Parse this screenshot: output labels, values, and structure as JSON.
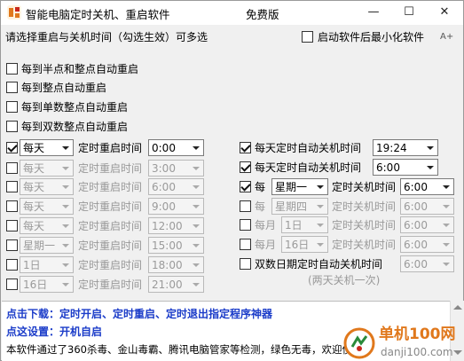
{
  "window": {
    "title": "智能电脑定时关机、重启软件",
    "edition": "免费版",
    "minimize_glyph": "—",
    "maximize_glyph": "☐",
    "close_glyph": "✕"
  },
  "header": {
    "instruction": "请选择重启与关机时间（勾选生效）可多选",
    "start_minimized": {
      "label": "启动软件后最小化软件",
      "checked": false
    },
    "font_size_icon": "A+"
  },
  "restart_options": [
    {
      "label": "每到半点和整点自动重启",
      "checked": false
    },
    {
      "label": "每到整点自动重启",
      "checked": false
    },
    {
      "label": "每到单数整点自动重启",
      "checked": false
    },
    {
      "label": "每到双数整点自动重启",
      "checked": false
    }
  ],
  "timed_restart": {
    "label": "定时重启时间",
    "rows": [
      {
        "checked": true,
        "day": "每天",
        "time": "0:00",
        "enabled": true
      },
      {
        "checked": false,
        "day": "每天",
        "time": "3:00",
        "enabled": false
      },
      {
        "checked": false,
        "day": "每天",
        "time": "6:00",
        "enabled": false
      },
      {
        "checked": false,
        "day": "每天",
        "time": "9:00",
        "enabled": false
      },
      {
        "checked": false,
        "day": "每天",
        "time": "12:00",
        "enabled": false
      },
      {
        "checked": false,
        "day": "星期一",
        "time": "15:00",
        "enabled": false
      },
      {
        "checked": false,
        "day": "1日",
        "time": "18:00",
        "enabled": false
      },
      {
        "checked": false,
        "day": "16日",
        "time": "21:00",
        "enabled": false
      }
    ]
  },
  "shutdown": {
    "rows": [
      {
        "checked": true,
        "label": "每天定时自动关机时间",
        "time": "19:24",
        "enabled": true
      },
      {
        "checked": true,
        "label": "每天定时自动关机时间",
        "time": "6:00",
        "enabled": true
      }
    ],
    "weekly": [
      {
        "checked": true,
        "prefix": "每",
        "day": "星期一",
        "label": "定时关机时间",
        "time": "6:00",
        "enabled": true
      },
      {
        "checked": false,
        "prefix": "每",
        "day": "星期四",
        "label": "定时关机时间",
        "time": "6:00",
        "enabled": false
      }
    ],
    "monthly": [
      {
        "checked": false,
        "prefix": "每月",
        "day": "1日",
        "label": "定时关机时间",
        "time": "6:00",
        "enabled": false
      },
      {
        "checked": false,
        "prefix": "每月",
        "day": "16日",
        "label": "定时关机时间",
        "time": "6:00",
        "enabled": false
      }
    ],
    "odd_even": {
      "checked": false,
      "label": "双数日期定时自动关机时间",
      "time": "6:00",
      "enabled": false
    },
    "note": "(两天关机一次)"
  },
  "footer": {
    "download_prefix": "点击下载：",
    "download_text": "定时开启、定时重启、定时退出指定程序神器",
    "settings_prefix": "点这设置：",
    "settings_text": "开机自启",
    "info": "本软件通过了360杀毒、金山毒霸、腾讯电脑管家等检测，绿色无毒，欢迎使"
  },
  "watermark": {
    "name": "单机100网",
    "url": "danji100.com"
  },
  "colors": {
    "link": "#1b3cc9",
    "icon_orange": "#e0781c",
    "icon_red": "#c8281e"
  }
}
